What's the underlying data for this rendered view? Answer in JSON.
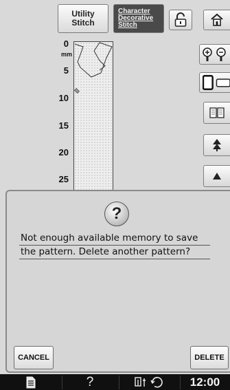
{
  "tabs": {
    "utility": "Utility Stitch",
    "character_lines": [
      "Character",
      "Decorative",
      "Stitch"
    ]
  },
  "ruler": {
    "unit": "mm",
    "labels": [
      "0",
      "5",
      "10",
      "15",
      "20",
      "25"
    ]
  },
  "dialog": {
    "message_lines": [
      "Not enough available memory to save",
      "the pattern. Delete another pattern?"
    ],
    "cancel_label": "CANCEL",
    "delete_label": "DELETE"
  },
  "statusbar": {
    "help": "?",
    "time": "12:00"
  },
  "icons": {
    "lock": "lock-icon",
    "home": "home-icon",
    "zoom_in": "zoom-in-icon",
    "zoom_out": "zoom-out-icon",
    "single_view": "single-view-icon",
    "double_view": "double-view-icon",
    "book": "book-icon",
    "scroll_top": "double-up-arrow-icon",
    "scroll_up": "up-arrow-icon",
    "document": "document-icon",
    "settings": "needle-settings-icon"
  },
  "colors": {
    "background": "#d9d9d9",
    "selected_tab": "#4a4a4a",
    "statusbar": "#101010"
  }
}
